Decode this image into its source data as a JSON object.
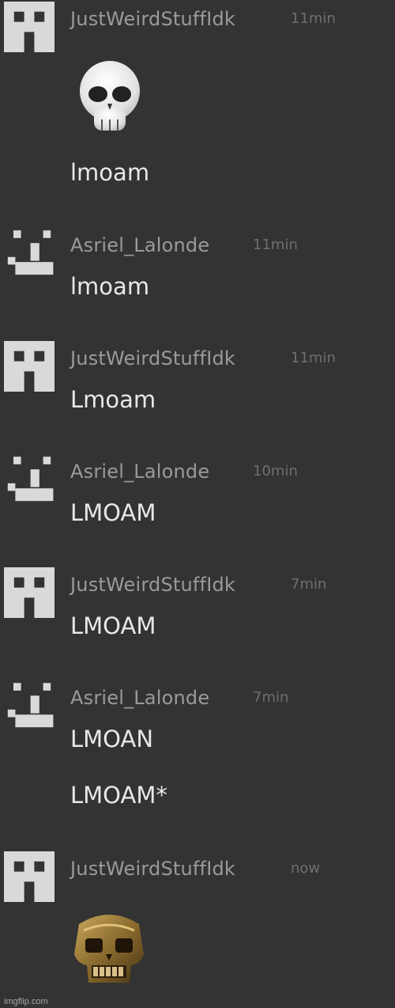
{
  "messages": [
    {
      "user": "JustWeirdStuffIdk",
      "time": "11min",
      "lines": [],
      "emoji": "skull-emoji"
    },
    {
      "user": "",
      "time": "",
      "lines": [
        "lmoam"
      ]
    },
    {
      "user": "Asriel_Lalonde",
      "time": "11min",
      "lines": [
        "lmoam"
      ]
    },
    {
      "user": "JustWeirdStuffIdk",
      "time": "11min",
      "lines": [
        "Lmoam"
      ]
    },
    {
      "user": "Asriel_Lalonde",
      "time": "10min",
      "lines": [
        "LMOAM"
      ]
    },
    {
      "user": "JustWeirdStuffIdk",
      "time": "7min",
      "lines": [
        "LMOAM"
      ]
    },
    {
      "user": "Asriel_Lalonde",
      "time": "7min",
      "lines": [
        "LMOAN",
        "LMOAM*"
      ]
    },
    {
      "user": "JustWeirdStuffIdk",
      "time": "now",
      "lines": [],
      "emoji": "golden-skull-emoji"
    }
  ],
  "colors": {
    "background": "#333333",
    "username": "#9a9a9a",
    "timestamp": "#6f6f6f",
    "message_text": "#e8e8e8",
    "avatar": "#d9d9d9"
  },
  "watermark": "imgflip.com"
}
